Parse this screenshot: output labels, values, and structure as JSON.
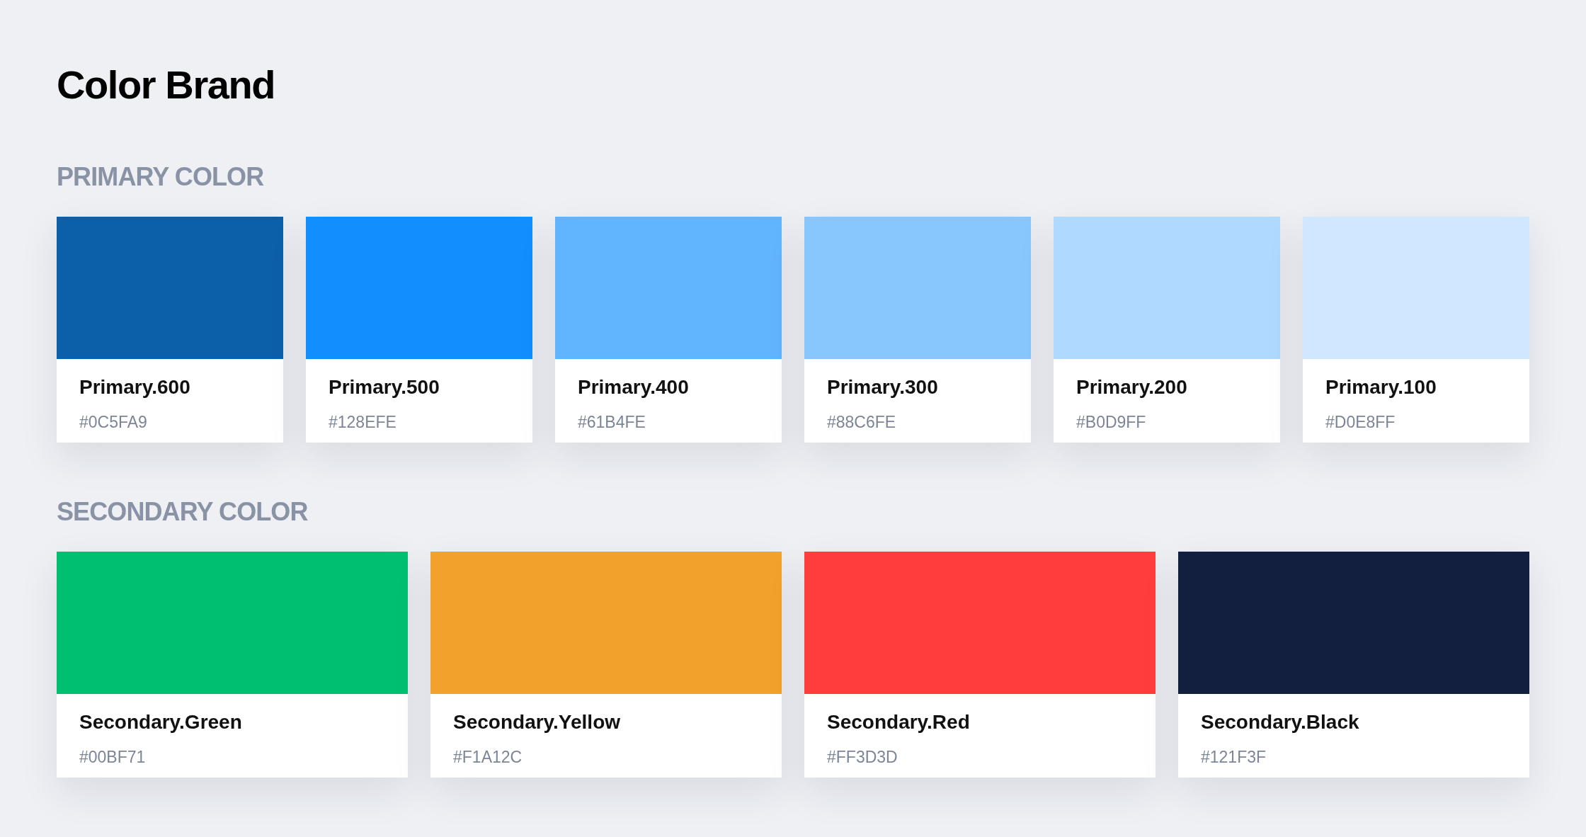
{
  "title": "Color Brand",
  "sections": [
    {
      "heading": "PRIMARY COLOR",
      "swatches": [
        {
          "name": "Primary.600",
          "hex": "#0C5FA9",
          "color": "#0c5fa9"
        },
        {
          "name": "Primary.500",
          "hex": "#128EFE",
          "color": "#128efe"
        },
        {
          "name": "Primary.400",
          "hex": "#61B4FE",
          "color": "#61b4fe"
        },
        {
          "name": "Primary.300",
          "hex": "#88C6FE",
          "color": "#88c6fe"
        },
        {
          "name": "Primary.200",
          "hex": "#B0D9FF",
          "color": "#b0d9ff"
        },
        {
          "name": "Primary.100",
          "hex": "#D0E8FF",
          "color": "#d0e8ff"
        }
      ]
    },
    {
      "heading": "SECONDARY COLOR",
      "swatches": [
        {
          "name": "Secondary.Green",
          "hex": "#00BF71",
          "color": "#00bf71"
        },
        {
          "name": "Secondary.Yellow",
          "hex": "#F1A12C",
          "color": "#f1a12c"
        },
        {
          "name": "Secondary.Red",
          "hex": "#FF3D3D",
          "color": "#ff3d3d"
        },
        {
          "name": "Secondary.Black",
          "hex": "#121F3F",
          "color": "#121f3f"
        }
      ]
    }
  ]
}
